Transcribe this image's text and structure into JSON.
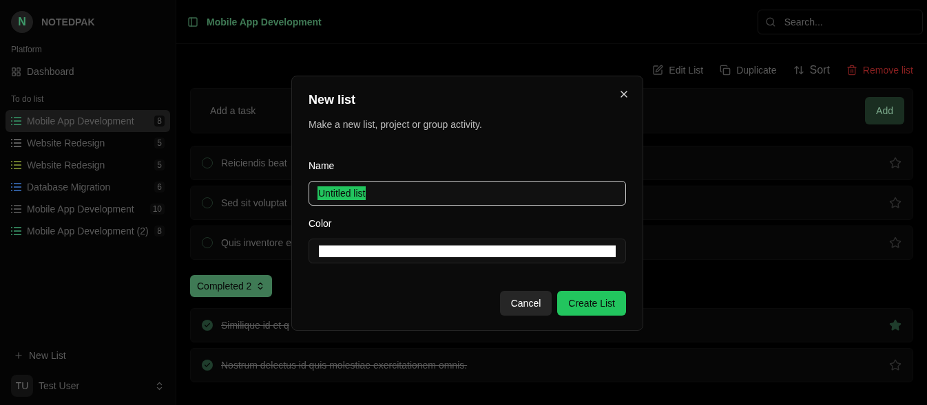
{
  "app": {
    "logo_letter": "N",
    "name": "NOTEDPAK"
  },
  "sidebar": {
    "sections": [
      {
        "title": "Platform",
        "items": [
          {
            "kind": "dashboard",
            "label": "Dashboard"
          }
        ]
      },
      {
        "title": "To do list",
        "items": [
          {
            "kind": "list",
            "label": "Mobile App Development",
            "count": "8",
            "color": "#2f7a55",
            "selected": true
          },
          {
            "kind": "list",
            "label": "Website Redesign",
            "count": "5",
            "color": "#5a5a5a",
            "selected": false
          },
          {
            "kind": "list",
            "label": "Website Redesign",
            "count": "5",
            "color": "#6b7a2a",
            "selected": false
          },
          {
            "kind": "list",
            "label": "Database Migration",
            "count": "6",
            "color": "#2f5a9a",
            "selected": false
          },
          {
            "kind": "list",
            "label": "Mobile App Development",
            "count": "10",
            "color": "#4a4a4a",
            "selected": false
          },
          {
            "kind": "list",
            "label": "Mobile App Development (2)",
            "count": "8",
            "color": "#2f7a55",
            "selected": false
          }
        ]
      }
    ],
    "new_list": "New List",
    "user": {
      "initials": "TU",
      "name": "Test User"
    }
  },
  "header": {
    "title": "Mobile App Development",
    "search": {
      "placeholder": "Search..."
    }
  },
  "toolbar": [
    {
      "kind": "edit",
      "label": "Edit List"
    },
    {
      "kind": "duplicate",
      "label": "Duplicate"
    },
    {
      "kind": "sort",
      "label": "Sort"
    },
    {
      "kind": "remove",
      "label": "Remove list"
    }
  ],
  "add_task": {
    "placeholder": "Add a task",
    "button": "Add"
  },
  "tasks": [
    {
      "text": "Reiciendis beat",
      "checked": false,
      "starred": false
    },
    {
      "text": "Sed sit voluptat",
      "checked": false,
      "starred": false
    },
    {
      "text": "Quis inventore e",
      "checked": false,
      "starred": false
    }
  ],
  "completed_toggle": "Completed 2",
  "completed_tasks": [
    {
      "text": "Similique id et q",
      "checked": true,
      "starred": true
    },
    {
      "text": "Nostrum delectus id quis molestiae exercitationem omnis.",
      "checked": true,
      "starred": false
    }
  ],
  "dialog": {
    "title": "New list",
    "description": "Make a new list, project or group activity.",
    "name_label": "Name",
    "name_value": "Untitled list",
    "color_label": "Color",
    "buttons": [
      {
        "kind": "secondary",
        "label": "Cancel"
      },
      {
        "kind": "primary",
        "label": "Create List"
      }
    ]
  }
}
